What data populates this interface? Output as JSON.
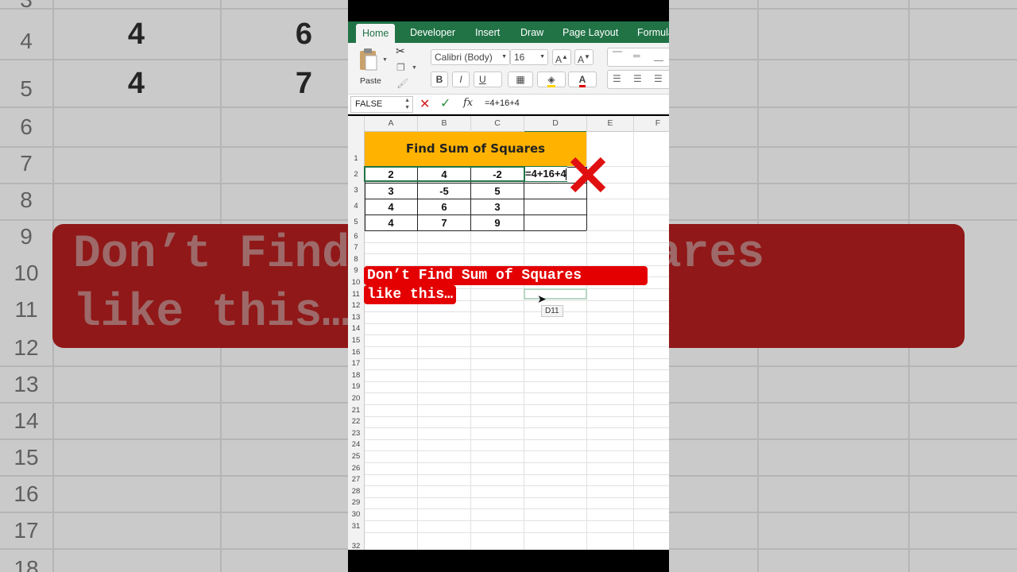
{
  "background": {
    "row_numbers": [
      "3",
      "4",
      "5",
      "6",
      "7",
      "8",
      "9",
      "10",
      "11",
      "12",
      "13",
      "14",
      "15",
      "16",
      "17",
      "18"
    ],
    "cells": [
      {
        "row": "4",
        "values": [
          "4",
          "6"
        ]
      },
      {
        "row": "5",
        "values": [
          "4",
          "7"
        ]
      }
    ],
    "banner_line1": "Don’t Find Sum of Squares",
    "banner_line2": "like this…"
  },
  "ribbon": {
    "tabs": [
      "Home",
      "Developer",
      "Insert",
      "Draw",
      "Page Layout",
      "Formulas"
    ],
    "active_tab": "Home",
    "paste_label": "Paste",
    "font_name": "Calibri (Body)",
    "font_size": "16",
    "bold": "B",
    "italic": "I",
    "underline": "U"
  },
  "formula_bar": {
    "name_box": "FALSE",
    "fx_label": "fx",
    "formula": "=4+16+4"
  },
  "sheet": {
    "columns": [
      "A",
      "B",
      "C",
      "D",
      "E",
      "F"
    ],
    "rows": [
      "1",
      "2",
      "3",
      "4",
      "5",
      "6",
      "7",
      "8",
      "9",
      "10",
      "11",
      "12",
      "13",
      "14",
      "15",
      "16",
      "17",
      "18",
      "19",
      "20",
      "21",
      "22",
      "23",
      "24",
      "25",
      "26",
      "27",
      "28",
      "29",
      "30",
      "31",
      "32"
    ],
    "title": "Find Sum of Squares",
    "data": [
      [
        "2",
        "4",
        "-2",
        "=4+16+4"
      ],
      [
        "3",
        "-5",
        "5",
        ""
      ],
      [
        "4",
        "6",
        "3",
        ""
      ],
      [
        "4",
        "7",
        "9",
        ""
      ]
    ],
    "tooltip": "D11"
  },
  "overlay": {
    "line1": "Don’t Find Sum of Squares",
    "line2": "like this…"
  },
  "colors": {
    "excel_green": "#217346",
    "title_fill": "#ffb300",
    "banner_red": "#e40000",
    "cross_red": "#e01010"
  }
}
